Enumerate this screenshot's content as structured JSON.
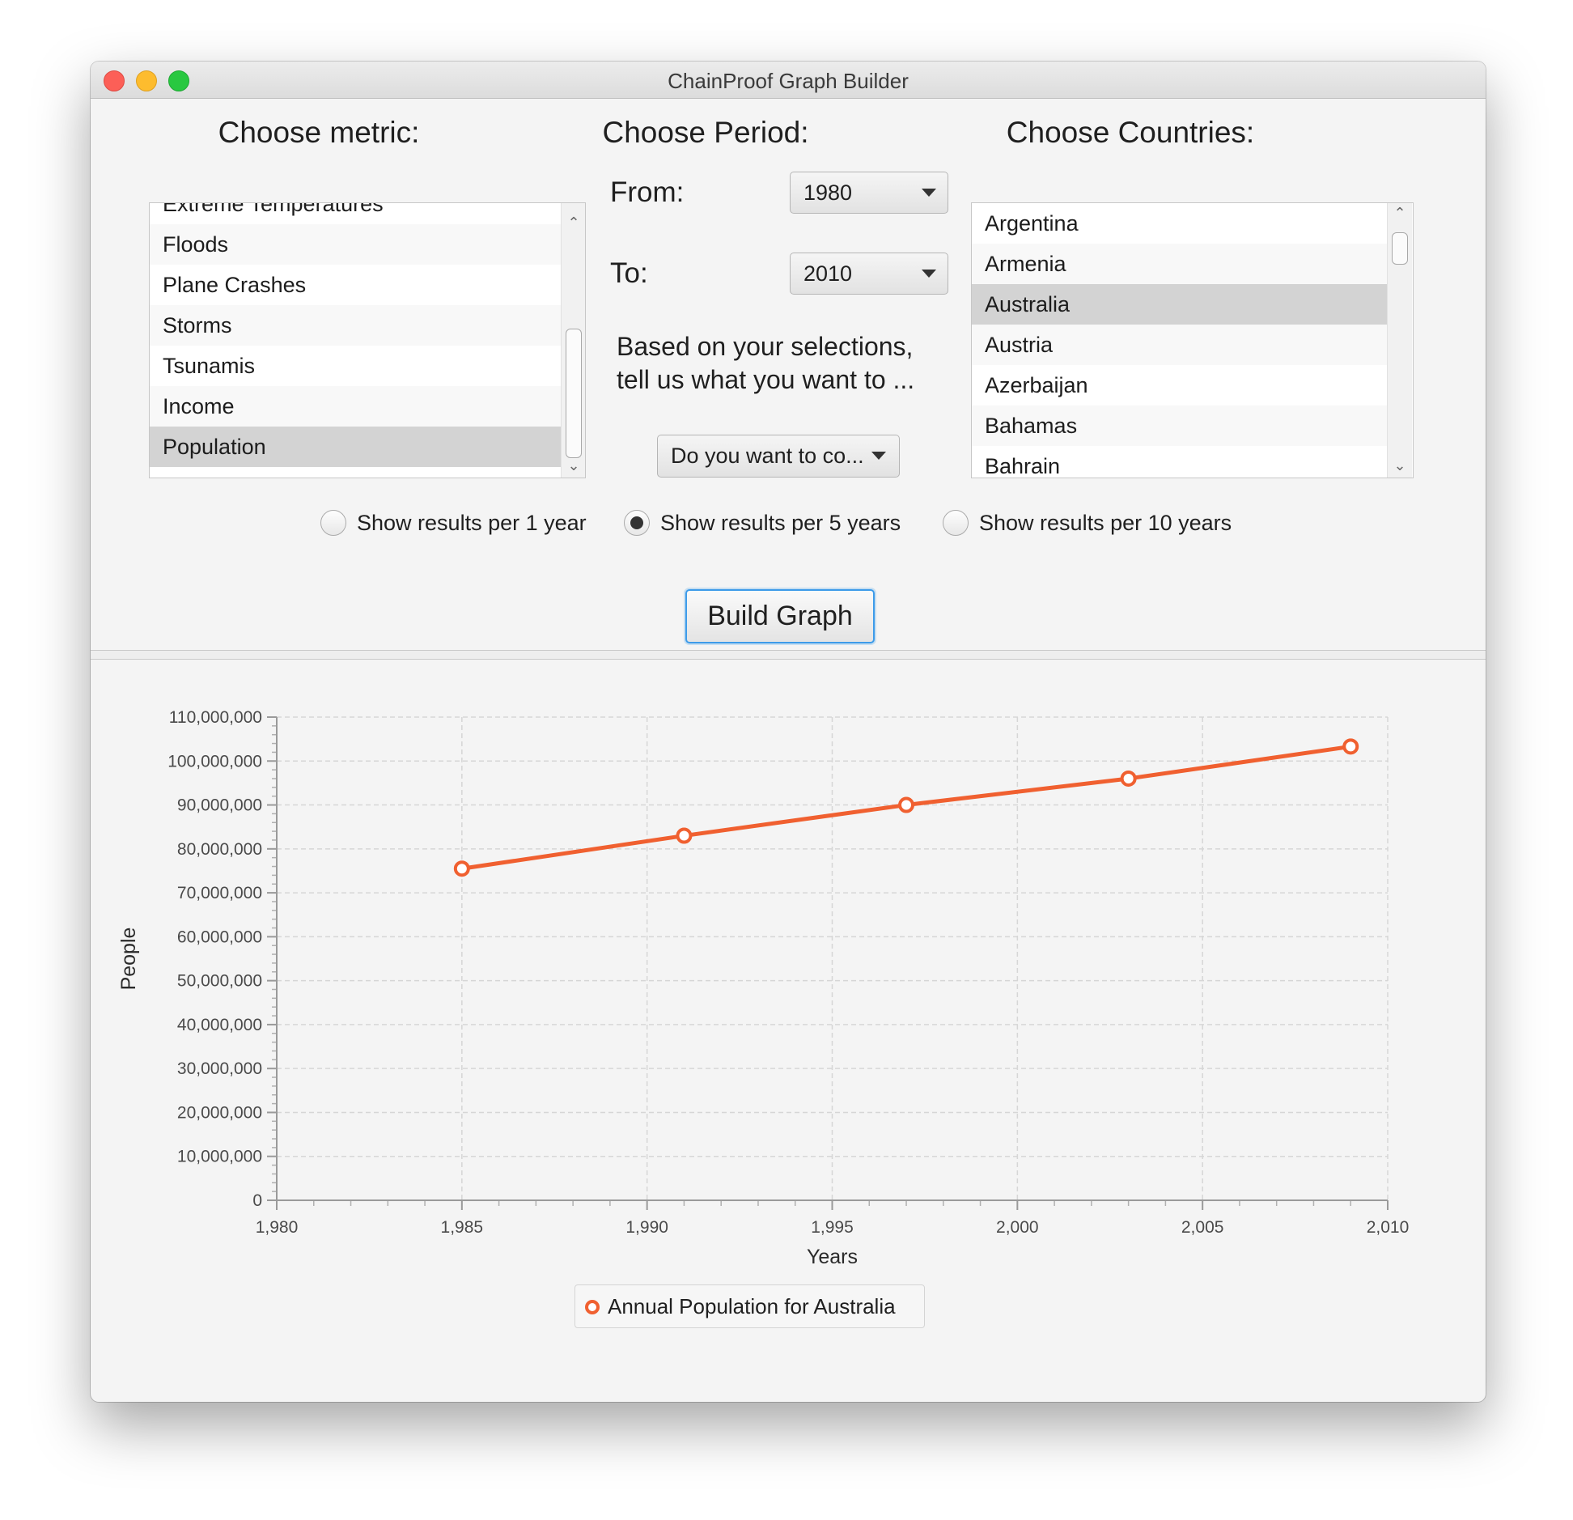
{
  "window": {
    "title": "ChainProof Graph Builder"
  },
  "metric": {
    "heading": "Choose metric:",
    "items": [
      "Extreme Temperatures",
      "Floods",
      "Plane Crashes",
      "Storms",
      "Tsunamis",
      "Income",
      "Population"
    ],
    "selected": "Population"
  },
  "period": {
    "heading": "Choose Period:",
    "from_label": "From:",
    "from_value": "1980",
    "to_label": "To:",
    "to_value": "2010",
    "prompt_line1": "Based on your selections,",
    "prompt_line2": "tell us what you want to ...",
    "question_value": "Do you want to co..."
  },
  "countries": {
    "heading": "Choose Countries:",
    "items": [
      "Argentina",
      "Armenia",
      "Australia",
      "Austria",
      "Azerbaijan",
      "Bahamas",
      "Bahrain"
    ],
    "selected": "Australia"
  },
  "resolution": {
    "options": [
      "Show results per 1 year",
      "Show results per 5 years",
      "Show results per 10 years"
    ],
    "selected_index": 1
  },
  "build_button": "Build Graph",
  "colors": {
    "series": "#f06030",
    "selection": "#d3d3d3",
    "focus": "#3d9be9"
  },
  "icons": {
    "scroll_up": "chevron-up-icon",
    "scroll_down": "chevron-down-icon",
    "dropdown": "triangle-down-icon"
  },
  "chart_data": {
    "type": "line",
    "title": "",
    "xlabel": "Years",
    "ylabel": "People",
    "xlim": [
      1980,
      2010
    ],
    "ylim": [
      0,
      110000000
    ],
    "x_ticks": [
      "1,980",
      "1,985",
      "1,990",
      "1,995",
      "2,000",
      "2,005",
      "2,010"
    ],
    "y_ticks": [
      "0",
      "10,000,000",
      "20,000,000",
      "30,000,000",
      "40,000,000",
      "50,000,000",
      "60,000,000",
      "70,000,000",
      "80,000,000",
      "90,000,000",
      "100,000,000",
      "110,000,000"
    ],
    "grid": true,
    "legend": "bottom-center",
    "series": [
      {
        "name": "Annual Population for Australia",
        "x": [
          1985,
          1991,
          1997,
          2003,
          2009
        ],
        "y": [
          75500000,
          83000000,
          90000000,
          96000000,
          103300000
        ]
      }
    ]
  }
}
